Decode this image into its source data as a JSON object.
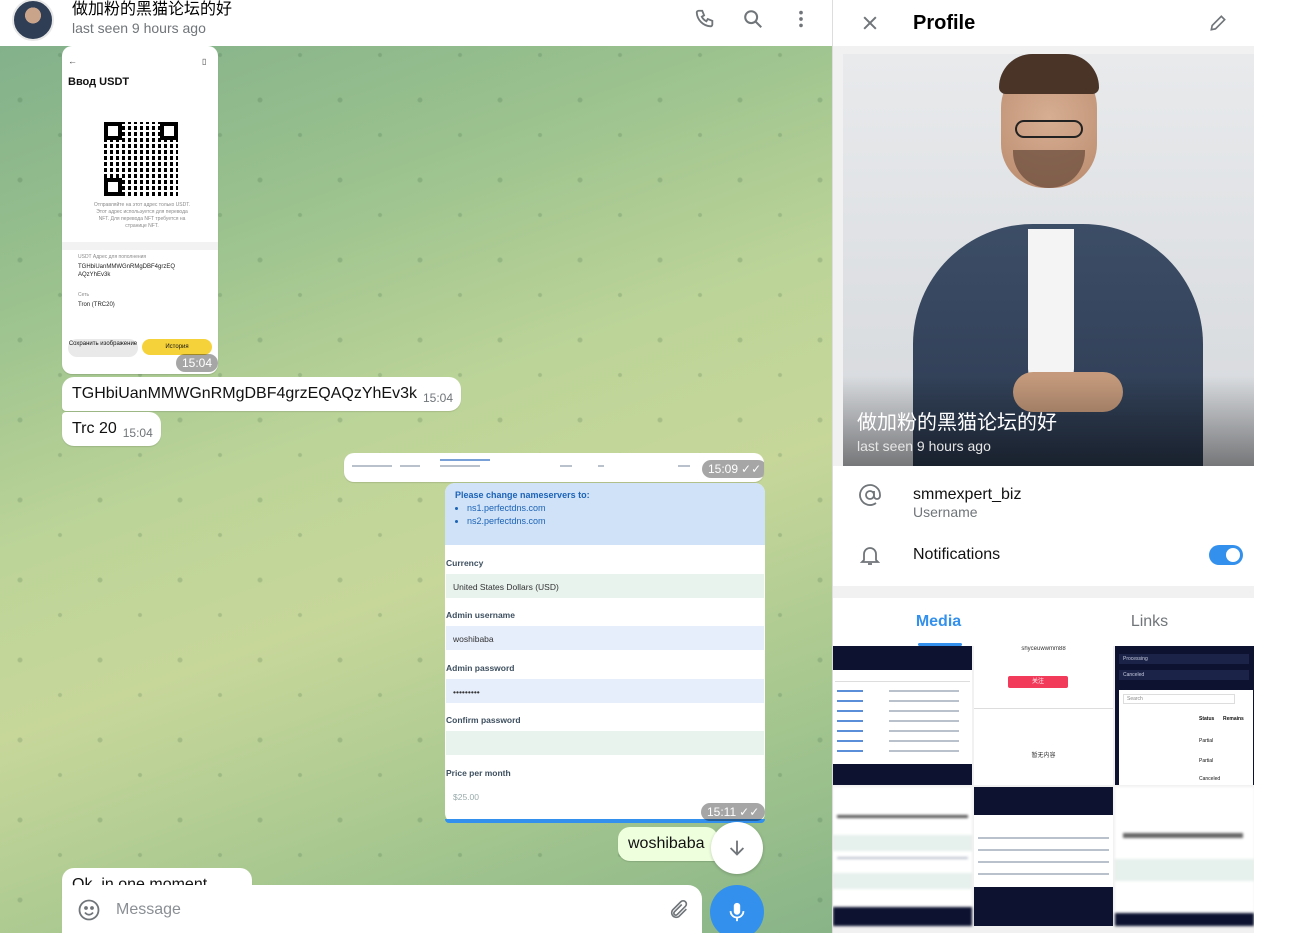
{
  "chat": {
    "title": "做加粉的黑猫论坛的好",
    "status": "last seen 9 hours ago",
    "messages": {
      "img1_time": "15:04",
      "text1": "TGHbiUanMMWGnRMgDBF4grzEQAQzYhEv3k",
      "text1_time": "15:04",
      "text2": "Trc 20",
      "text2_time": "15:04",
      "img2_time": "15:09",
      "img3_time": "15:11",
      "text3": "woshibaba",
      "text4": "Ok, in one moment"
    },
    "phone_shot": {
      "title": "Ввод USDT",
      "caption": "Отправляйте на этот адрес только USDT. Этот адрес используется для перевода NFT. Для перевода NFT требуется на странице NFT.",
      "addr_label": "USDT Адрес для пополнения",
      "address": "TGHbiUanMMWGnRMgDBF4grzEQ AQzYhEv3k",
      "net_label": "Сеть",
      "network": "Tron (TRC20)",
      "save_btn": "Сохранить изображение",
      "history_btn": "История"
    },
    "panel_shot": {
      "notice_title": "Please change nameservers to:",
      "ns1": "ns1.perfectdns.com",
      "ns2": "ns2.perfectdns.com",
      "currency_label": "Currency",
      "currency_value": "United States Dollars (USD)",
      "admin_user_label": "Admin username",
      "admin_user_value": "woshibaba",
      "admin_pass_label": "Admin password",
      "admin_pass_value": "•••••••••",
      "confirm_label": "Confirm password",
      "price_label": "Price per month",
      "price_value": "$25.00"
    },
    "input_placeholder": "Message"
  },
  "profile": {
    "header_title": "Profile",
    "name": "做加粉的黑猫论坛的好",
    "status": "last seen 9 hours ago",
    "username": "smmexpert_biz",
    "username_label": "Username",
    "notifications_label": "Notifications",
    "notifications_on": true,
    "tabs": [
      "Media",
      "Links"
    ],
    "media_thumb_texts": {
      "m2_title": "shyceuwwmm88",
      "m2_btn": "关注",
      "m2_sub": "暂无内容",
      "m3_row1": "Processing",
      "m3_row2": "Canceled",
      "m3_search": "Search",
      "m3_status": "Status",
      "m3_remains": "Remains",
      "m3_partial": "Partial",
      "m3_canceled": "Canceled"
    }
  },
  "colors": {
    "accent": "#3390ec",
    "header_bg": "#ffffff",
    "secondary_text": "#707579"
  }
}
